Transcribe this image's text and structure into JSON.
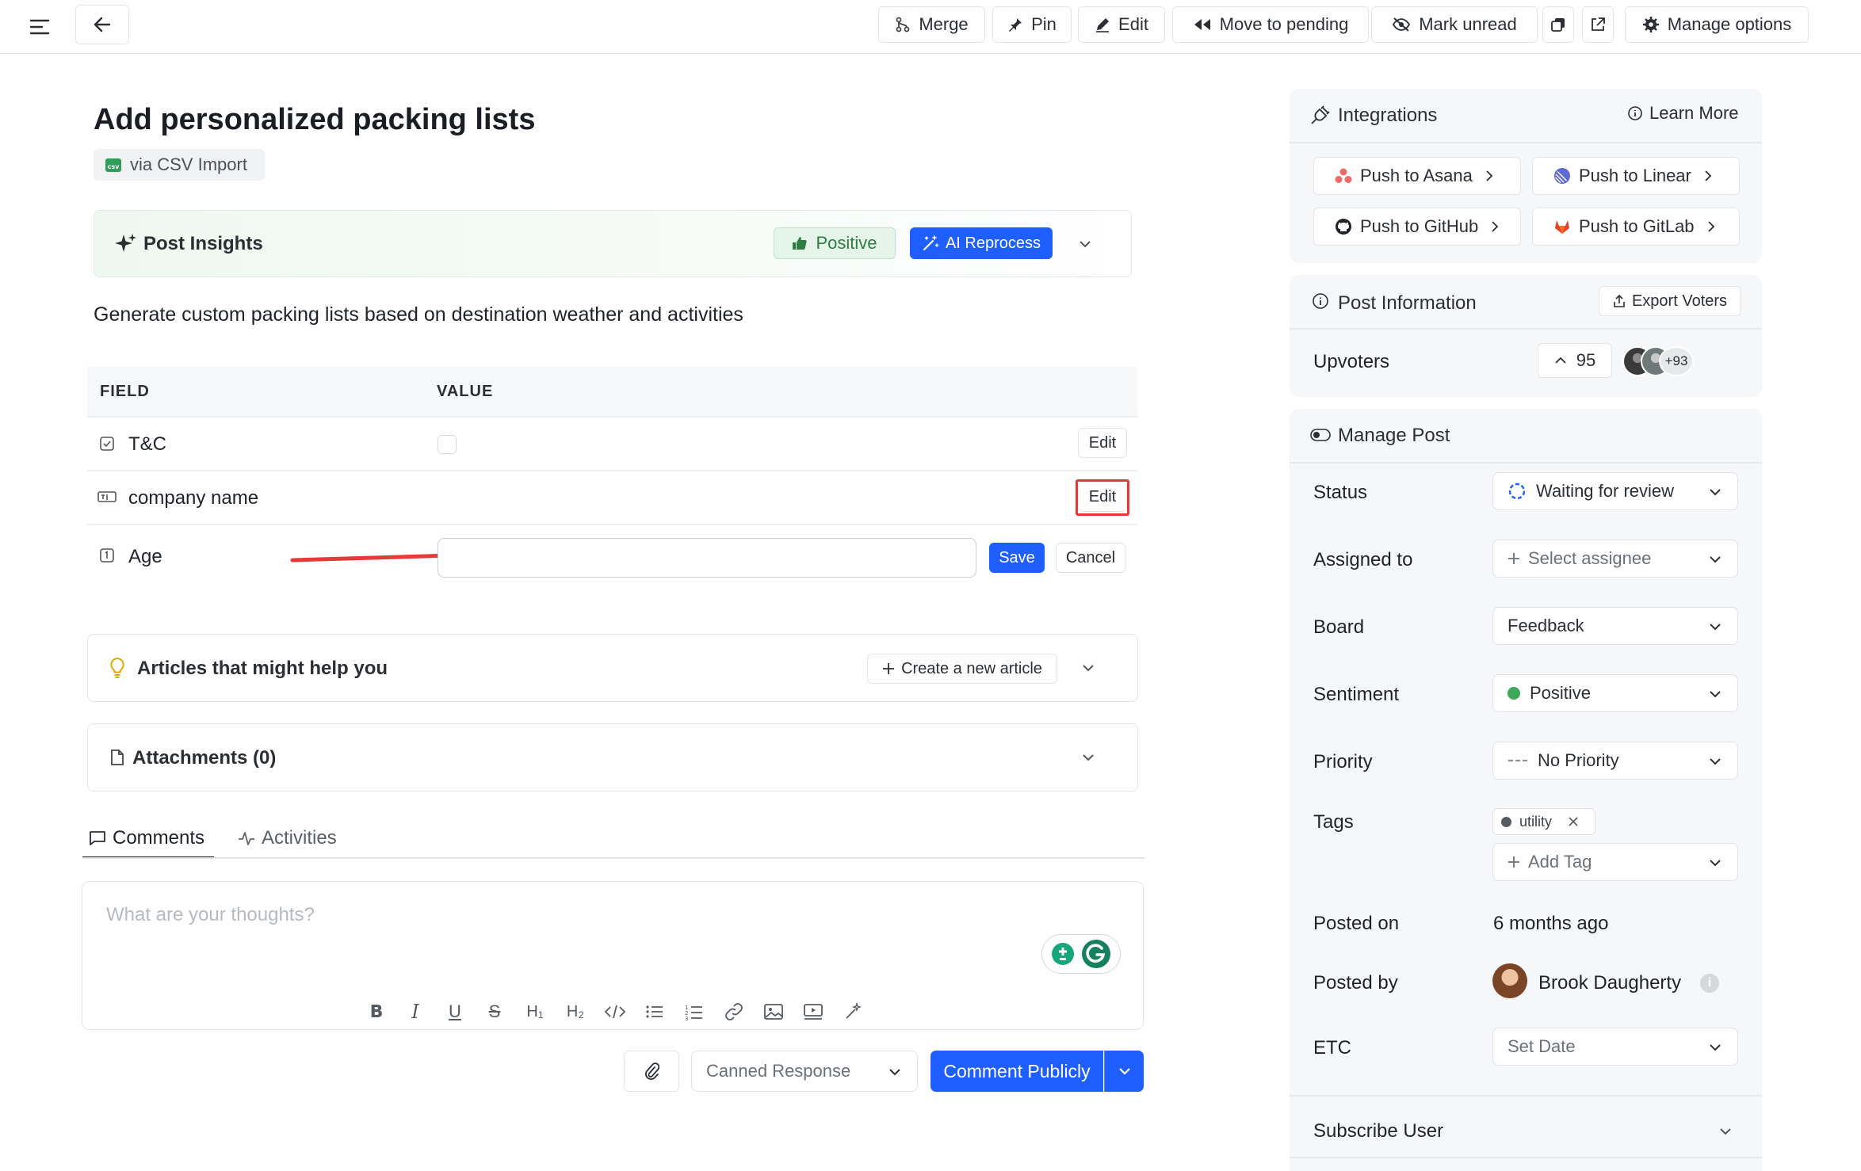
{
  "toolbar": {
    "merge": "Merge",
    "pin": "Pin",
    "edit": "Edit",
    "move_to_pending": "Move to pending",
    "mark_unread": "Mark unread",
    "manage_options": "Manage options"
  },
  "post": {
    "title": "Add personalized packing lists",
    "source": "via CSV Import",
    "description": "Generate custom packing lists based on destination weather and activities"
  },
  "insights": {
    "title": "Post Insights",
    "sentiment_badge": "Positive",
    "reprocess": "AI Reprocess"
  },
  "fields_table": {
    "headers": [
      "FIELD",
      "VALUE"
    ],
    "rows": [
      {
        "field": "T&C",
        "action": "Edit"
      },
      {
        "field": "company name",
        "action": "Edit"
      },
      {
        "field": "Age",
        "input_value": "",
        "save": "Save",
        "cancel": "Cancel"
      }
    ]
  },
  "articles": {
    "title": "Articles that might help you",
    "create": "Create a new article"
  },
  "attachments": {
    "title": "Attachments (0)"
  },
  "tabs": [
    {
      "label": "Comments",
      "active": true
    },
    {
      "label": "Activities",
      "active": false
    }
  ],
  "comment_box": {
    "placeholder": "What are your thoughts?",
    "canned_response": "Canned Response",
    "submit": "Comment Publicly"
  },
  "integrations": {
    "title": "Integrations",
    "learn_more": "Learn More",
    "buttons": [
      "Push to Asana",
      "Push to Linear",
      "Push to GitHub",
      "Push to GitLab"
    ]
  },
  "post_information": {
    "title": "Post Information",
    "export": "Export Voters",
    "upvoters_label": "Upvoters",
    "upvote_count": "95",
    "extra_voters": "+93"
  },
  "manage_post": {
    "title": "Manage Post",
    "status_label": "Status",
    "status_value": "Waiting for review",
    "assigned_label": "Assigned to",
    "assigned_value": "Select assignee",
    "board_label": "Board",
    "board_value": "Feedback",
    "sentiment_label": "Sentiment",
    "sentiment_value": "Positive",
    "priority_label": "Priority",
    "priority_value": "No Priority",
    "tags_label": "Tags",
    "tag": "utility",
    "add_tag": "Add Tag",
    "posted_on_label": "Posted on",
    "posted_on_value": "6 months ago",
    "posted_by_label": "Posted by",
    "posted_by_value": "Brook Daugherty",
    "etc_label": "ETC",
    "etc_value": "Set Date"
  },
  "subscribe": {
    "title": "Subscribe User"
  },
  "colors": {
    "accent": "#1f5eff",
    "positive": "#3fa65a",
    "highlight": "#e53935",
    "annotation_arrow": "#e53a3a"
  }
}
